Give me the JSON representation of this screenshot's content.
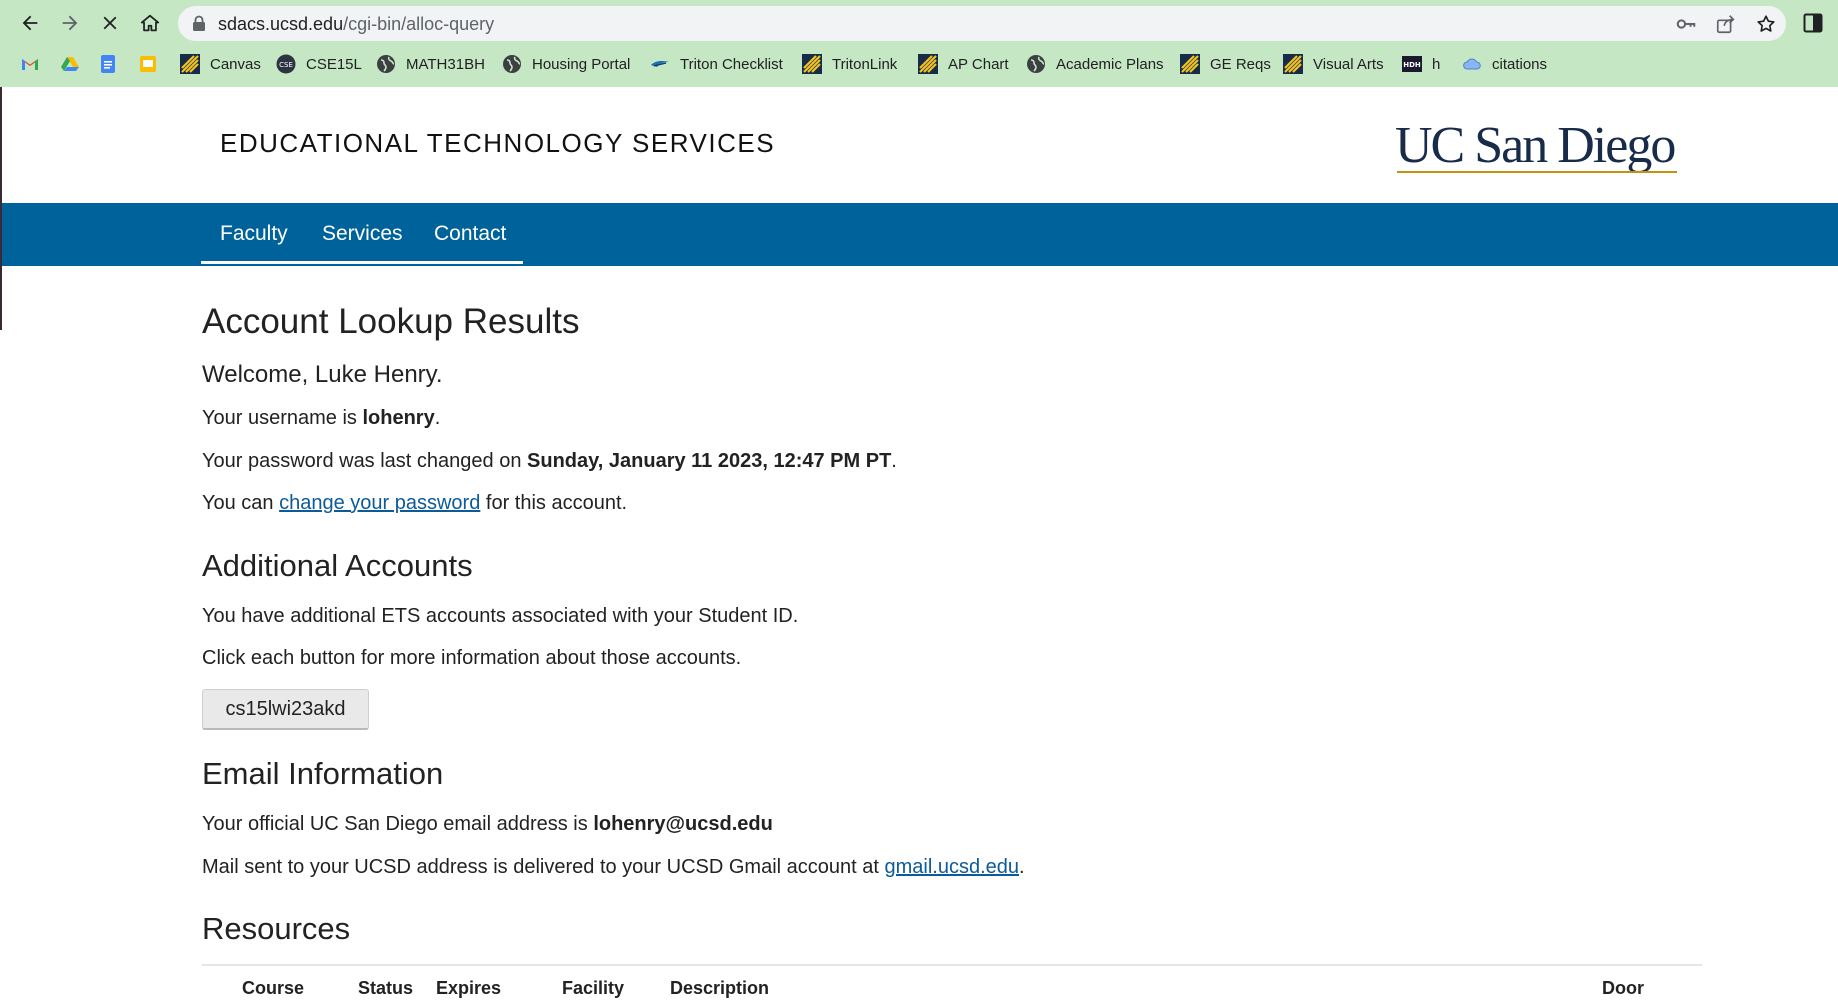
{
  "browser": {
    "url_host": "sdacs.ucsd.edu",
    "url_path": "/cgi-bin/alloc-query",
    "bookmarks": [
      {
        "label": "",
        "icon": "gmail-icon"
      },
      {
        "label": "",
        "icon": "google-drive-icon"
      },
      {
        "label": "",
        "icon": "google-docs-icon"
      },
      {
        "label": "",
        "icon": "google-slides-icon"
      },
      {
        "label": "Canvas",
        "icon": "triton-stripes-icon"
      },
      {
        "label": "CSE15L",
        "icon": "cse-badge-icon"
      },
      {
        "label": "MATH31BH",
        "icon": "globe-icon"
      },
      {
        "label": "Housing Portal",
        "icon": "globe-icon"
      },
      {
        "label": "Triton Checklist",
        "icon": "trident-icon"
      },
      {
        "label": "TritonLink",
        "icon": "triton-stripes-icon"
      },
      {
        "label": "AP Chart",
        "icon": "triton-stripes-icon"
      },
      {
        "label": "Academic Plans",
        "icon": "globe-icon"
      },
      {
        "label": "GE Reqs",
        "icon": "triton-stripes-icon"
      },
      {
        "label": "Visual Arts",
        "icon": "triton-stripes-icon"
      },
      {
        "label": "h",
        "icon": "hdh-icon"
      },
      {
        "label": "citations",
        "icon": "onedrive-cloud-icon"
      }
    ]
  },
  "site": {
    "title": "EDUCATIONAL TECHNOLOGY SERVICES",
    "logo_text": "UC San Diego",
    "nav": [
      "Faculty",
      "Services",
      "Contact"
    ]
  },
  "main": {
    "heading": "Account Lookup Results",
    "welcome": "Welcome, Luke Henry.",
    "username_prefix": "Your username is ",
    "username": "lohenry",
    "username_suffix": ".",
    "password_prefix": "Your password was last changed on ",
    "password_date": "Sunday, January 11 2023, 12:47 PM PT",
    "password_suffix": ".",
    "change_prefix": "You can ",
    "change_link": "change your password",
    "change_suffix": " for this account."
  },
  "additional": {
    "heading": "Additional Accounts",
    "line1": "You have additional ETS accounts associated with your Student ID.",
    "line2": "Click each button for more information about those accounts.",
    "account_button": "cs15lwi23akd"
  },
  "email": {
    "heading": "Email Information",
    "official_prefix": "Your official UC San Diego email address is ",
    "address": "lohenry@ucsd.edu",
    "mail_prefix": "Mail sent to your UCSD address is delivered to your UCSD Gmail account at ",
    "gmail_link": "gmail.ucsd.edu",
    "mail_suffix": "."
  },
  "resources": {
    "heading": "Resources",
    "columns": [
      "Course",
      "Status",
      "Expires",
      "Facility",
      "Description",
      "Door"
    ]
  }
}
